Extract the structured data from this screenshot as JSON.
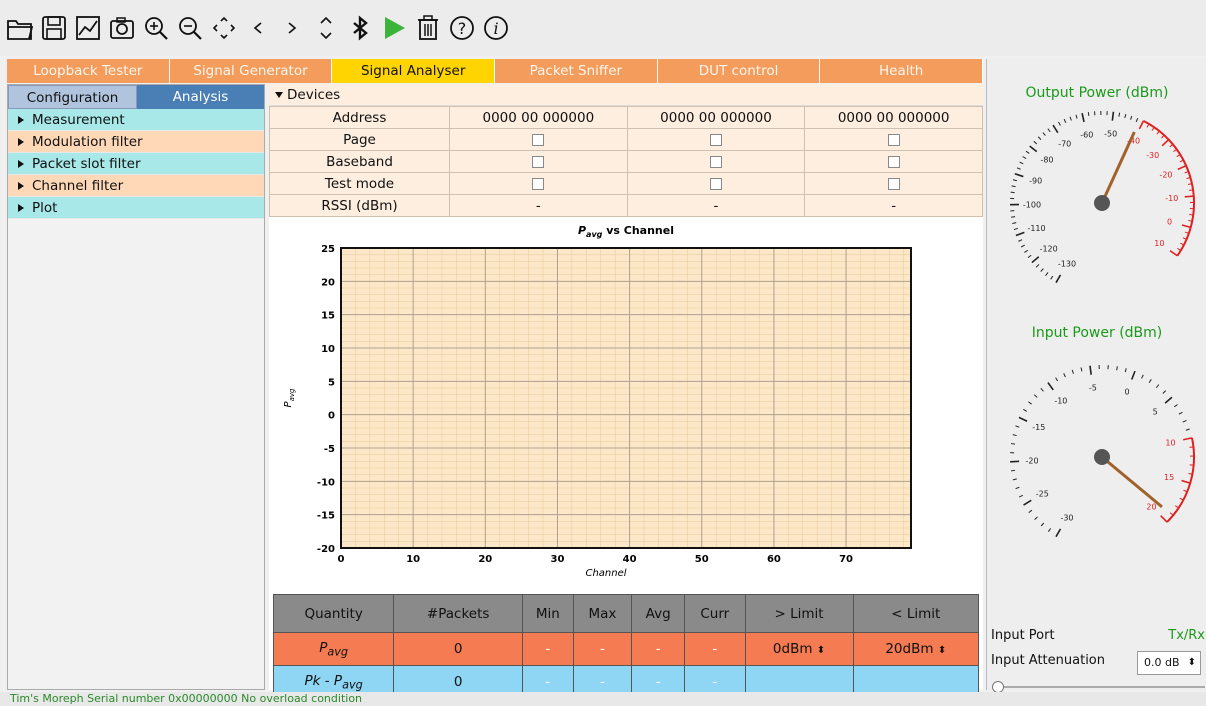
{
  "toolbar": {
    "icons": [
      "open-folder-icon",
      "save-icon",
      "chart-icon",
      "camera-icon",
      "zoom-in-icon",
      "zoom-out-icon",
      "pan-icon",
      "prev-icon",
      "next-icon",
      "expand-icon",
      "bluetooth-icon",
      "play-icon",
      "trash-icon",
      "help-icon",
      "info-icon"
    ],
    "accent_play": "#3cb43c"
  },
  "main_tabs": [
    "Loopback Tester",
    "Signal Generator",
    "Signal Analyser",
    "Packet Sniffer",
    "DUT control",
    "Health"
  ],
  "active_tab": "Signal Analyser",
  "left": {
    "subtabs": [
      "Configuration",
      "Analysis"
    ],
    "tree": [
      "Measurement",
      "Modulation filter",
      "Packet slot filter",
      "Channel filter",
      "Plot"
    ]
  },
  "devices": {
    "header": "Devices",
    "rows": [
      {
        "label": "Address",
        "values": [
          "0000 00 000000",
          "0000 00 000000",
          "0000 00 000000"
        ]
      },
      {
        "label": "Page",
        "values": [
          "",
          "",
          ""
        ]
      },
      {
        "label": "Baseband",
        "values": [
          "",
          "",
          ""
        ]
      },
      {
        "label": "Test mode",
        "values": [
          "",
          "",
          ""
        ]
      },
      {
        "label": "RSSI (dBm)",
        "values": [
          "-",
          "-",
          "-"
        ]
      }
    ]
  },
  "chart_data": {
    "type": "scatter",
    "title_main": "P",
    "title_sub": "avg",
    "title_rest": " vs Channel",
    "xlabel": "Channel",
    "ylabel_main": "P",
    "ylabel_sub": "avg",
    "xlim": [
      0,
      79
    ],
    "ylim": [
      -20,
      25
    ],
    "xticks": [
      0,
      10,
      20,
      30,
      40,
      50,
      60,
      70
    ],
    "yticks": [
      25,
      20,
      15,
      10,
      5,
      0,
      -5,
      -10,
      -15,
      -20
    ],
    "grid": true,
    "series": [],
    "background": "#fce8c8",
    "grid_color": "#e8c89a"
  },
  "stats": {
    "headers": [
      "Quantity",
      "#Packets",
      "Min",
      "Max",
      "Avg",
      "Curr",
      "> Limit",
      "< Limit"
    ],
    "rows": [
      {
        "q_main": "P",
        "q_sub": "avg",
        "packets": "0",
        "min": "-",
        "max": "-",
        "avg": "-",
        "curr": "-",
        "gt": "0dBm",
        "lt": "20dBm"
      },
      {
        "q_main": "Pk - P",
        "q_sub": "avg",
        "packets": "0",
        "min": "-",
        "max": "-",
        "avg": "-",
        "curr": "-",
        "gt": "",
        "lt": ""
      }
    ]
  },
  "gauges": {
    "output": {
      "title": "Output Power (dBm)",
      "labels": [
        "-130",
        "-120",
        "-110",
        "-100",
        "-90",
        "-80",
        "-70",
        "-60",
        "-50",
        "-40",
        "-30",
        "-20",
        "-10",
        "0",
        "10"
      ]
    },
    "input": {
      "title": "Input Power (dBm)",
      "labels": [
        "-30",
        "-25",
        "-20",
        "-15",
        "-10",
        "-5",
        "0",
        "5",
        "10",
        "15",
        "20"
      ]
    }
  },
  "input_port": {
    "label": "Input Port",
    "value": "Tx/Rx"
  },
  "input_attenuation": {
    "label": "Input Attenuation",
    "value": "0.0 dB"
  },
  "status_bar": "Tim's Moreph   Serial number 0x00000000   No overload condition"
}
